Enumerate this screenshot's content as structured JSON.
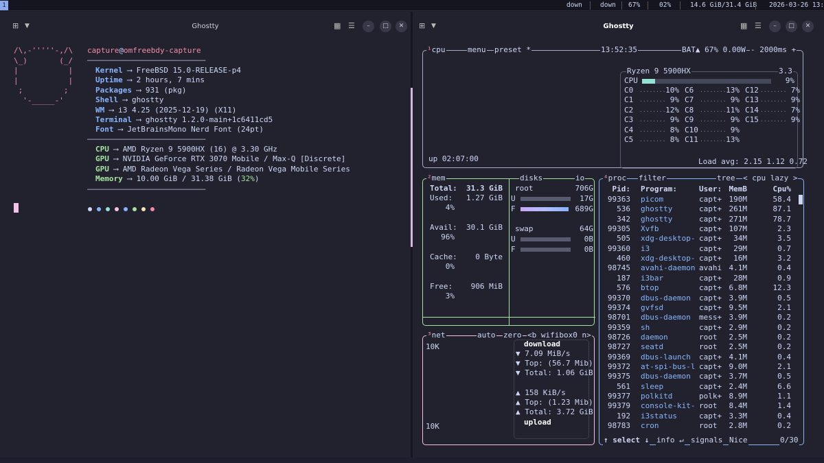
{
  "statusbar": {
    "workspace": "1",
    "net_down": "down",
    "net_down2": "down",
    "battery": "67%",
    "cpu": "02%",
    "memory": "14.6 GiB/31.4 GiB",
    "datetime": "2026-03-26 13:52"
  },
  "left_window": {
    "title": "Ghostty"
  },
  "right_window": {
    "title": "Ghostty"
  },
  "fetch": {
    "logo": [
      "/\\,-'''''-,/\\",
      "\\_)       (_/",
      "|           |",
      "|           |",
      " ;         ;",
      "  '-_____-'"
    ],
    "user": "capture",
    "host": "omfreebdy-capture",
    "rows": [
      {
        "key": "Kernel",
        "val": "FreeBSD 15.0-RELEASE-p4",
        "color": "#89b4fa"
      },
      {
        "key": "Uptime",
        "val": "2 hours, 7 mins",
        "color": "#89b4fa"
      },
      {
        "key": "Packages",
        "val": "931 (pkg)",
        "color": "#89b4fa"
      },
      {
        "key": "Shell",
        "val": "ghostty",
        "color": "#89b4fa"
      },
      {
        "key": "WM",
        "val": "i3 4.25 (2025-12-19) (X11)",
        "color": "#89b4fa"
      },
      {
        "key": "Terminal",
        "val": "ghostty 1.2.0-main+1c6411cd5",
        "color": "#89b4fa"
      },
      {
        "key": "Font",
        "val": "JetBrainsMono Nerd Font (24pt)",
        "color": "#89b4fa"
      }
    ],
    "hw": [
      {
        "key": "CPU",
        "val": "AMD Ryzen 9 5900HX (16) @ 3.30 GHz"
      },
      {
        "key": "GPU",
        "val": "NVIDIA GeForce RTX 3070 Mobile / Max-Q [Discrete]"
      },
      {
        "key": "GPU",
        "val": "AMD Radeon Vega Series / Radeon Vega Mobile Series"
      },
      {
        "key": "Memory",
        "val": "10.00 GiB / 31.38 GiB (",
        "pct": "32%",
        "tail": ")"
      }
    ],
    "palette": [
      "#cdd6f4",
      "#89b4fa",
      "#94e2d5",
      "#f5c2e7",
      "#89b4fa",
      "#a6e3a1",
      "#f9e2af",
      "#f38ba8"
    ]
  },
  "btop": {
    "cpu_box": {
      "num": "¹",
      "label": "cpu",
      "menu": "menu",
      "preset": "preset *",
      "time": "13:52:35",
      "bat": "BAT▲ 67% 0.00W",
      "rate": "- 2000ms +",
      "uptime": "up 02:07:00",
      "model": "Ryzen 9 5900HX",
      "freq": "3.3",
      "total_label": "CPU",
      "total_pct": "9%",
      "cores": [
        [
          "C0",
          "10%"
        ],
        [
          "C1",
          "9%"
        ],
        [
          "C2",
          "12%"
        ],
        [
          "C3",
          "9%"
        ],
        [
          "C4",
          "8%"
        ],
        [
          "C5",
          "8%"
        ],
        [
          "C6",
          "13%"
        ],
        [
          "C7",
          "9%"
        ],
        [
          "C8",
          "11%"
        ],
        [
          "C9",
          "9%"
        ],
        [
          "C10",
          "9%"
        ],
        [
          "C11",
          "13%"
        ],
        [
          "C12",
          "7%"
        ],
        [
          "C13",
          "9%"
        ],
        [
          "C14",
          "7%"
        ],
        [
          "C15",
          "9%"
        ]
      ],
      "load": "Load avg: 2.15 1.12 0.72"
    },
    "mem_box": {
      "num": "²",
      "label": "mem",
      "total_label": "Total:",
      "total": "31.3 GiB",
      "items": [
        {
          "label": "Used:",
          "val": "1.27 GiB",
          "pct": "4%"
        },
        {
          "label": "Avail:",
          "val": "30.1 GiB",
          "pct": "96%"
        },
        {
          "label": "Cache:",
          "val": "0 Byte",
          "pct": "0%"
        },
        {
          "label": "Free:",
          "val": "906 MiB",
          "pct": "3%"
        }
      ]
    },
    "disks": {
      "label": "disks",
      "io": "io",
      "root": "root",
      "root_size": "706G",
      "u_label": "U",
      "u_val": "17G",
      "f_label": "F",
      "f_val": "689G",
      "swap": "swap",
      "swap_size": "64G",
      "su_label": "U",
      "su_val": "0B",
      "sf_label": "F",
      "sf_val": "0B"
    },
    "net_box": {
      "num": "³",
      "label": "net",
      "auto": "auto",
      "zero": "zero",
      "iface": "<b wifibox0 n>",
      "top": "10K",
      "bottom": "10K",
      "download": "download",
      "d_rate": "▼ 7.09 MiB/s",
      "d_top": "▼ Top: (56.7 Mib)",
      "d_total": "▼ Total: 1.06 GiB",
      "u_rate": "▲ 158 KiB/s",
      "u_top": "▲ Top: (1.23 Mib)",
      "u_total": "▲ Total: 3.72 GiB",
      "upload": "upload"
    },
    "proc_box": {
      "num": "⁴",
      "label": "proc",
      "filter": "filter",
      "tree": "tree",
      "sort": "< cpu lazy >",
      "headers": [
        "Pid:",
        "Program:",
        "User:",
        "MemB",
        "Cpu%"
      ],
      "rows": [
        [
          "99363",
          "picom",
          "capt+",
          "190M",
          "58.4"
        ],
        [
          "536",
          "ghostty",
          "capt+",
          "261M",
          "87.1"
        ],
        [
          "342",
          "ghostty",
          "capt+",
          "271M",
          "78.7"
        ],
        [
          "99305",
          "Xvfb",
          "capt+",
          "107M",
          "2.3"
        ],
        [
          "505",
          "xdg-desktop-",
          "capt+",
          "34M",
          "3.5"
        ],
        [
          "99360",
          "i3",
          "capt+",
          "29M",
          "0.7"
        ],
        [
          "460",
          "xdg-desktop-",
          "capt+",
          "16M",
          "3.2"
        ],
        [
          "98745",
          "avahi-daemon",
          "avahi",
          "4.1M",
          "0.4"
        ],
        [
          "187",
          "i3bar",
          "capt+",
          "28M",
          "0.9"
        ],
        [
          "576",
          "btop",
          "capt+",
          "6.8M",
          "12.3"
        ],
        [
          "99370",
          "dbus-daemon",
          "capt+",
          "3.9M",
          "0.5"
        ],
        [
          "99374",
          "gvfsd",
          "capt+",
          "9.5M",
          "2.1"
        ],
        [
          "98701",
          "dbus-daemon",
          "mess+",
          "3.9M",
          "0.2"
        ],
        [
          "99359",
          "sh",
          "capt+",
          "2.9M",
          "0.2"
        ],
        [
          "98726",
          "daemon",
          "root",
          "2.5M",
          "0.2"
        ],
        [
          "98727",
          "seatd",
          "root",
          "2.5M",
          "0.2"
        ],
        [
          "99369",
          "dbus-launch",
          "capt+",
          "4.1M",
          "0.4"
        ],
        [
          "99372",
          "at-spi-bus-l",
          "capt+",
          "9.0M",
          "2.1"
        ],
        [
          "99375",
          "dbus-daemon",
          "capt+",
          "3.7M",
          "0.5"
        ],
        [
          "561",
          "sleep",
          "capt+",
          "2.4M",
          "6.6"
        ],
        [
          "99377",
          "polkitd",
          "polk+",
          "8.9M",
          "1.1"
        ],
        [
          "99379",
          "console-kit-",
          "root",
          "8.4M",
          "1.4"
        ],
        [
          "192",
          "i3status",
          "capt+",
          "3.3M",
          "0.4"
        ],
        [
          "98783",
          "cron",
          "root",
          "2.8M",
          "0.2"
        ]
      ],
      "footer_select": "↑ select ↓",
      "footer_info": "info ↵",
      "footer_signals": "signals",
      "footer_nice": "Nice",
      "count": "0/30"
    }
  }
}
